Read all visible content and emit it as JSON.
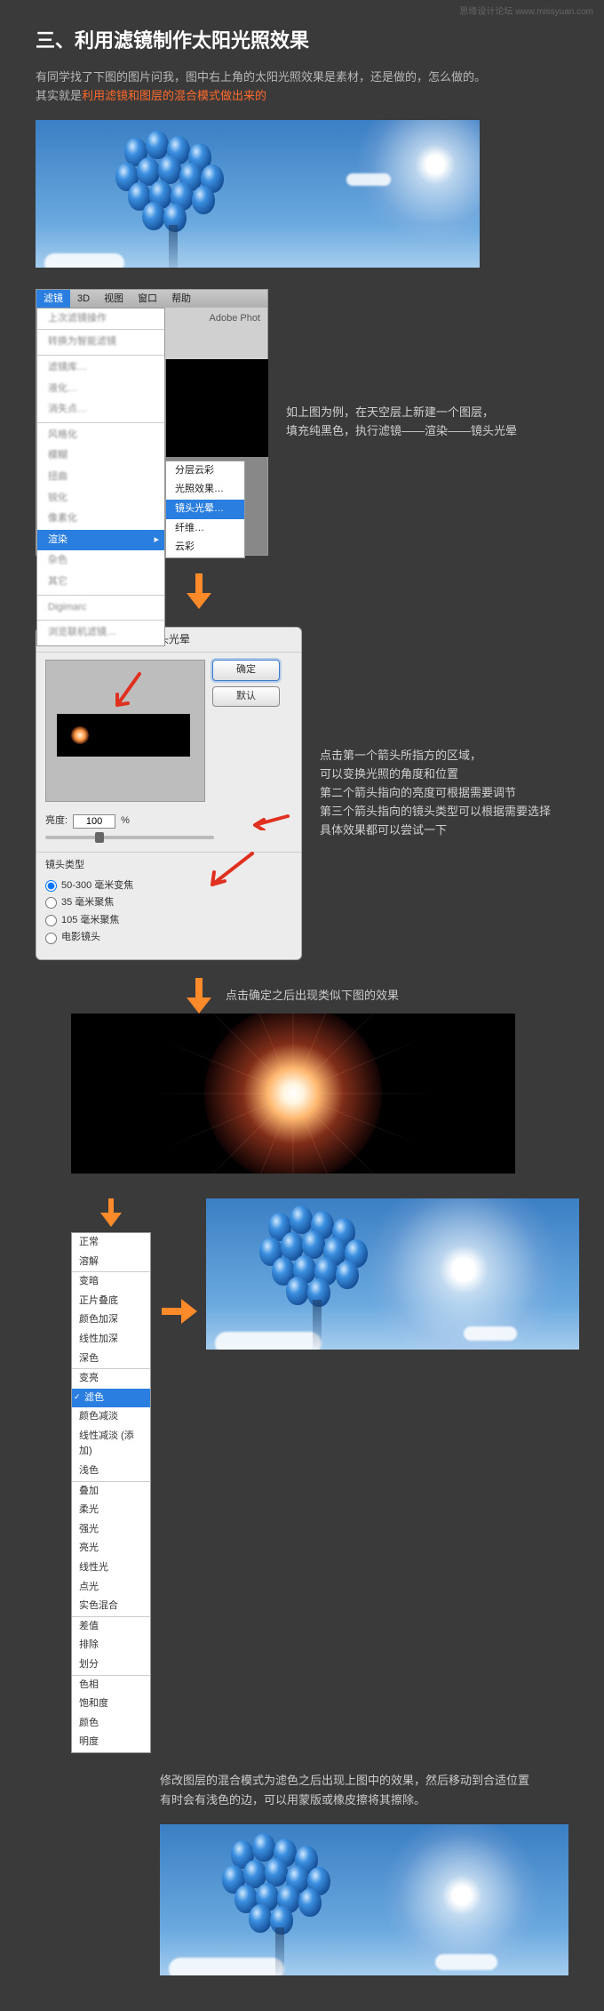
{
  "watermark": "思缘设计论坛 www.missyuan.com",
  "title": "三、利用滤镜制作太阳光照效果",
  "intro_line1": "有同学找了下图的图片问我，图中右上角的太阳光照效果是素材，还是做的，怎么做的。",
  "intro_line2_pre": "其实就是",
  "intro_line2_hl": "利用滤镜和图层的混合模式做出来的",
  "menu": {
    "tabs": [
      "滤镜",
      "3D",
      "视图",
      "窗口",
      "帮助"
    ],
    "adobe_label": "Adobe Phot",
    "render_label": "渲染",
    "submenu": [
      "分层云彩",
      "光照效果…",
      "镜头光晕…",
      "纤维…",
      "云彩"
    ]
  },
  "step1_text_line1": "如上图为例，在天空层上新建一个图层，",
  "step1_text_line2": "填充纯黑色，执行滤镜——渲染——镜头光晕",
  "dialog": {
    "title": "镜头光晕",
    "ok": "确定",
    "cancel": "默认",
    "brightness_label": "亮度:",
    "brightness_value": "100",
    "brightness_unit": "%",
    "lens_label": "镜头类型",
    "options": [
      "50-300 毫米变焦",
      "35 毫米聚焦",
      "105 毫米聚焦",
      "电影镜头"
    ]
  },
  "dlg_side": [
    "点击第一个箭头所指方的区域，",
    "可以变换光照的角度和位置",
    "第二个箭头指向的亮度可根据需要调节",
    "第三个箭头指向的镜头类型可以根据需要选择",
    "具体效果都可以尝试一下"
  ],
  "caption_after_dialog": "点击确定之后出现类似下图的效果",
  "blend_modes": {
    "groups": [
      [
        "正常",
        "溶解"
      ],
      [
        "变暗",
        "正片叠底",
        "颜色加深",
        "线性加深",
        "深色"
      ],
      [
        "变亮",
        "滤色",
        "颜色减淡",
        "线性减淡 (添加)",
        "浅色"
      ],
      [
        "叠加",
        "柔光",
        "强光",
        "亮光",
        "线性光",
        "点光",
        "实色混合"
      ],
      [
        "差值",
        "排除",
        "划分"
      ],
      [
        "色相",
        "饱和度",
        "颜色",
        "明度"
      ]
    ],
    "selected": "滤色"
  },
  "final_text_line1": "修改图层的混合模式为滤色之后出现上图中的效果，然后移动到合适位置",
  "final_text_line2": "有时会有浅色的边，可以用蒙版或橡皮擦将其擦除。"
}
